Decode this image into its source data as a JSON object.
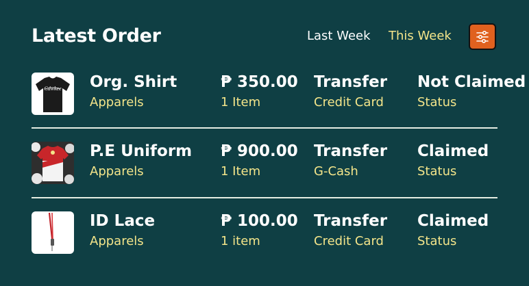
{
  "header": {
    "title": "Latest Order",
    "tab_last_week": "Last Week",
    "tab_this_week": "This Week",
    "filter_icon": "sliders-icon"
  },
  "colors": {
    "background": "#0f3f44",
    "accent_yellow": "#f4e58a",
    "filter_button": "#e0611f"
  },
  "orders": [
    {
      "name": "Org. Shirt",
      "category": "Apparels",
      "price": "₱ 350.00",
      "quantity": "1 Item",
      "payment": "Transfer",
      "method": "Credit Card",
      "status": "Not Claimed",
      "status_label": "Status",
      "thumbnail_text": "Cdwkee",
      "thumbnail": "black-shirt-image"
    },
    {
      "name": "P.E Uniform",
      "category": "Apparels",
      "price": "₱ 900.00",
      "quantity": "1 Item",
      "payment": "Transfer",
      "method": "G-Cash",
      "status": "Claimed",
      "status_label": "Status",
      "thumbnail": "pe-uniform-image"
    },
    {
      "name": "ID Lace",
      "category": "Apparels",
      "price": "₱ 100.00",
      "quantity": "1 item",
      "payment": "Transfer",
      "method": "Credit Card",
      "status": "Claimed",
      "status_label": "Status",
      "thumbnail": "id-lace-image"
    }
  ]
}
